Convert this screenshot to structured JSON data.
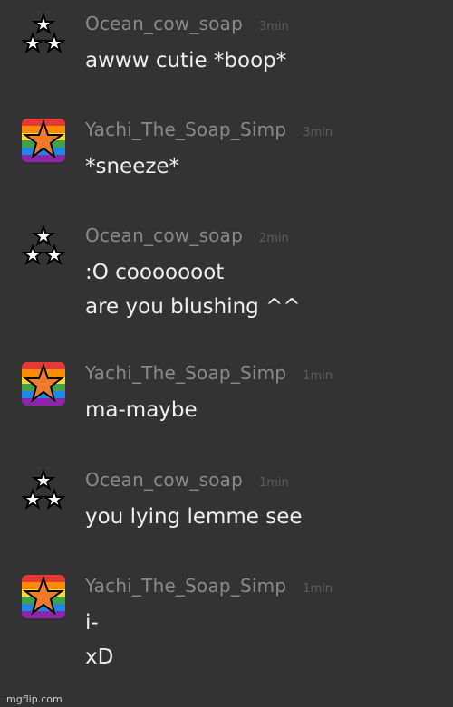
{
  "colors": {
    "background": "#333333",
    "username": "#8a8a8a",
    "timestamp": "#5c5c5c",
    "message_text": "#efefef"
  },
  "messages": [
    {
      "user": "Ocean_cow_soap",
      "time": "3min",
      "avatar": "three-stars-icon",
      "lines": [
        "awww cutie *boop*"
      ]
    },
    {
      "user": "Yachi_The_Soap_Simp",
      "time": "3min",
      "avatar": "rainbow-star-icon",
      "lines": [
        "*sneeze*"
      ]
    },
    {
      "user": "Ocean_cow_soap",
      "time": "2min",
      "avatar": "three-stars-icon",
      "lines": [
        ":O cooooooot",
        "are you blushing ^^"
      ]
    },
    {
      "user": "Yachi_The_Soap_Simp",
      "time": "1min",
      "avatar": "rainbow-star-icon",
      "lines": [
        "ma-maybe"
      ]
    },
    {
      "user": "Ocean_cow_soap",
      "time": "1min",
      "avatar": "three-stars-icon",
      "lines": [
        "you lying lemme see"
      ]
    },
    {
      "user": "Yachi_The_Soap_Simp",
      "time": "1min",
      "avatar": "rainbow-star-icon",
      "lines": [
        "i-",
        "xD"
      ]
    }
  ],
  "watermark": "imgflip.com"
}
